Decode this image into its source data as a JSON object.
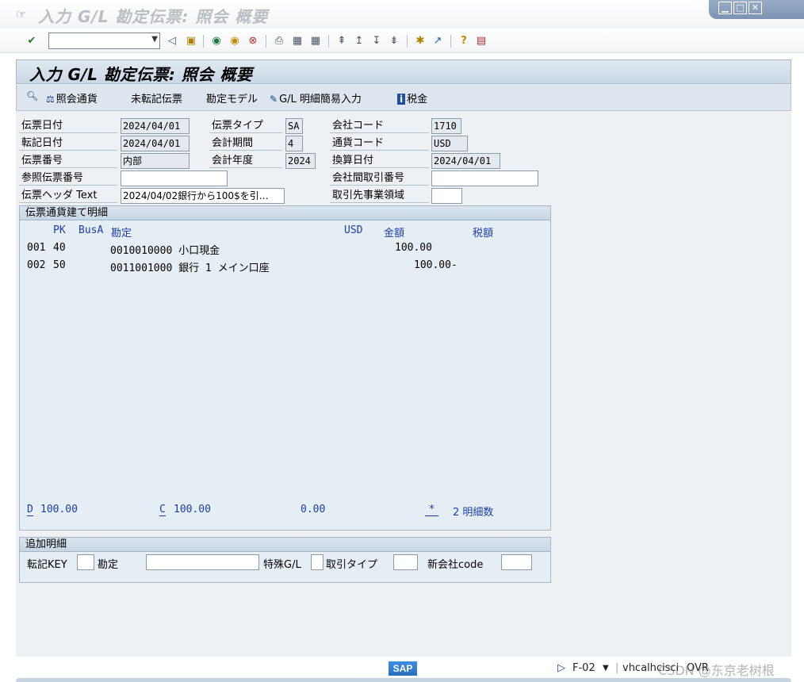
{
  "window": {
    "title": "入力 G/L 勘定伝票: 照会 概要",
    "buttons": {
      "minimize": "▁",
      "maximize": "□",
      "close": "✕"
    }
  },
  "toolbar": {
    "command_placeholder": "",
    "icons": [
      "enter-icon",
      "back-icon",
      "save-icon",
      "back-nav-icon",
      "exit-icon",
      "cancel-icon",
      "print-icon",
      "find-icon",
      "find-next-icon",
      "first-page-icon",
      "prev-page-icon",
      "next-page-icon",
      "last-page-icon",
      "new-session-icon",
      "shortcut-icon",
      "help-icon",
      "layout-icon"
    ]
  },
  "app": {
    "title": "入力 G/L 勘定伝票: 照会 概要",
    "toolbar": {
      "display_currency": "照会通貨",
      "park_document": "未転記伝票",
      "account_model": "勘定モデル",
      "gl_fast_entry": "G/L 明細簡易入力",
      "taxes": "税金"
    }
  },
  "header": {
    "doc_date_label": "伝票日付",
    "doc_date": "2024/04/01",
    "doc_type_label": "伝票タイプ",
    "doc_type": "SA",
    "company_code_label": "会社コード",
    "company_code": "1710",
    "posting_date_label": "転記日付",
    "posting_date": "2024/04/01",
    "period_label": "会計期間",
    "period": "4",
    "currency_label": "通貨コード",
    "currency": "USD",
    "doc_number_label": "伝票番号",
    "doc_number": "内部",
    "fiscal_year_label": "会計年度",
    "fiscal_year": "2024",
    "translation_date_label": "換算日付",
    "translation_date": "2024/04/01",
    "reference_label": "参照伝票番号",
    "reference": "",
    "intercompany_label": "会社間取引番号",
    "intercompany": "",
    "header_text_label": "伝票ヘッダ Text",
    "header_text": "2024/04/02銀行から100$を引…",
    "trading_partner_label": "取引先事業領域",
    "trading_partner": ""
  },
  "items": {
    "title": "伝票通貨建て明細",
    "columns": {
      "pk": "PK",
      "busa": "BusA",
      "account": "勘定",
      "currency": "USD",
      "amount": "金額",
      "tax": "税額"
    },
    "rows": [
      {
        "no": "001",
        "pk": "40",
        "account": "0010010000 小口現金",
        "amount": "100.00"
      },
      {
        "no": "002",
        "pk": "50",
        "account": "0011001000 銀行 1 メイン口座",
        "amount": "100.00-"
      }
    ],
    "totals": {
      "debit_label": "D",
      "debit": "100.00",
      "credit_label": "C",
      "credit": "100.00",
      "balance": "0.00",
      "star": "*",
      "count_text": "2 明細数"
    }
  },
  "additional": {
    "title": "追加明細",
    "posting_key_label": "転記KEY",
    "posting_key": "",
    "account_label": "勘定",
    "account": "",
    "special_gl_label": "特殊G/L",
    "special_gl": "",
    "trans_type_label": "取引タイプ",
    "trans_type": "",
    "new_company_label": "新会社code",
    "new_company": ""
  },
  "status": {
    "logo": "SAP",
    "transaction": "F-02",
    "server": "vhcalhcisci",
    "mode": "OVR",
    "watermark": "CSDN @东京老树根"
  }
}
